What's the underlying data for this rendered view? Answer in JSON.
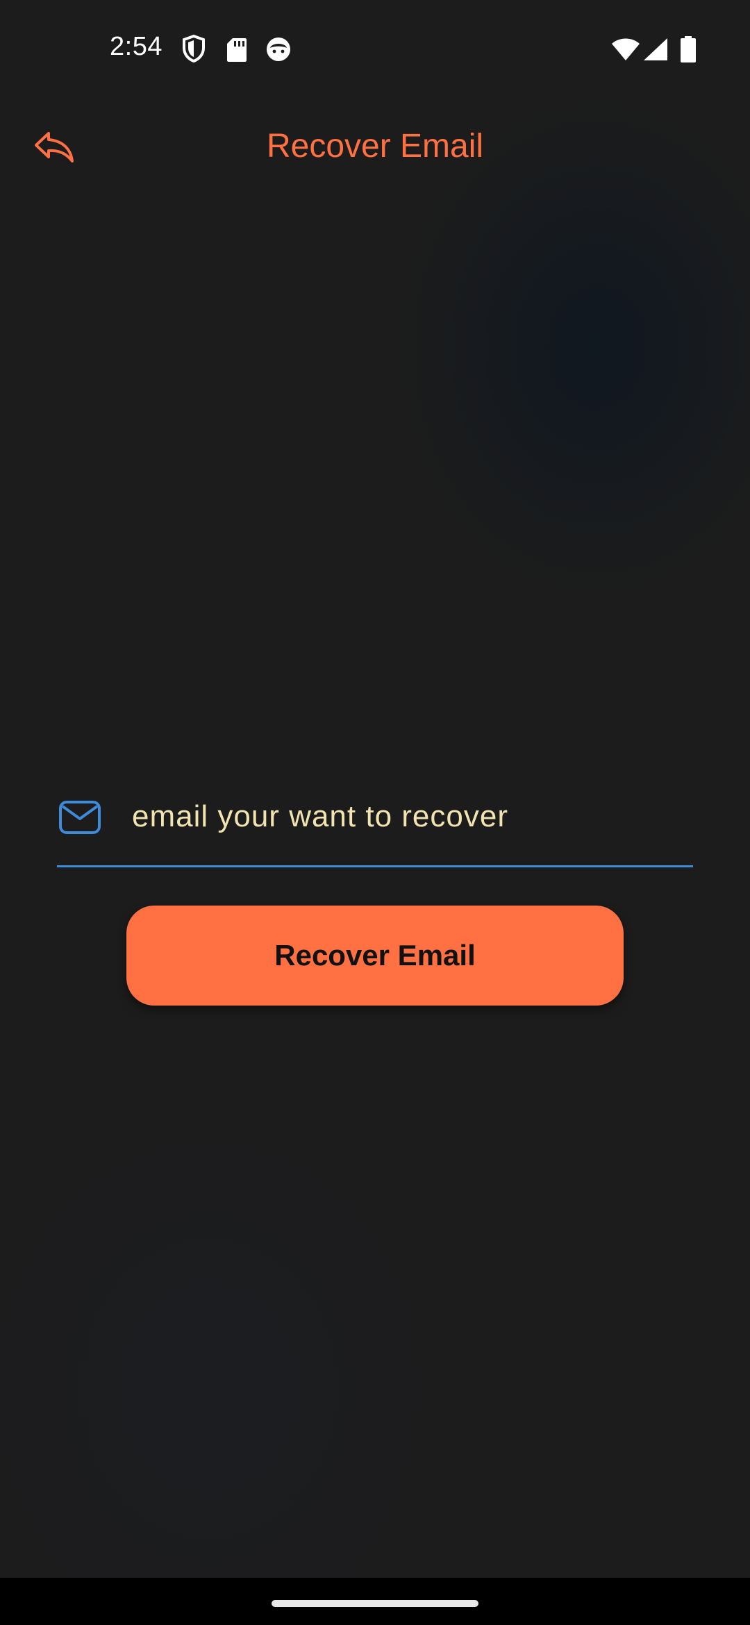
{
  "status_bar": {
    "time": "2:54",
    "left_icons": [
      "shield-icon",
      "sd-card-icon",
      "face-icon"
    ],
    "right_icons": [
      "wifi-icon",
      "cellular-signal-icon",
      "battery-icon"
    ]
  },
  "app_bar": {
    "back_icon": "reply-arrow-icon",
    "title": "Recover Email"
  },
  "form": {
    "email_icon": "mail-icon",
    "email_placeholder": "email your want to recover",
    "email_value": "",
    "submit_label": "Recover Email"
  },
  "colors": {
    "accent": "#ff7043",
    "background": "#1c1c1c",
    "field_underline": "#3d8bd9",
    "placeholder_text": "#f1e4b0",
    "button_text": "#111111"
  }
}
